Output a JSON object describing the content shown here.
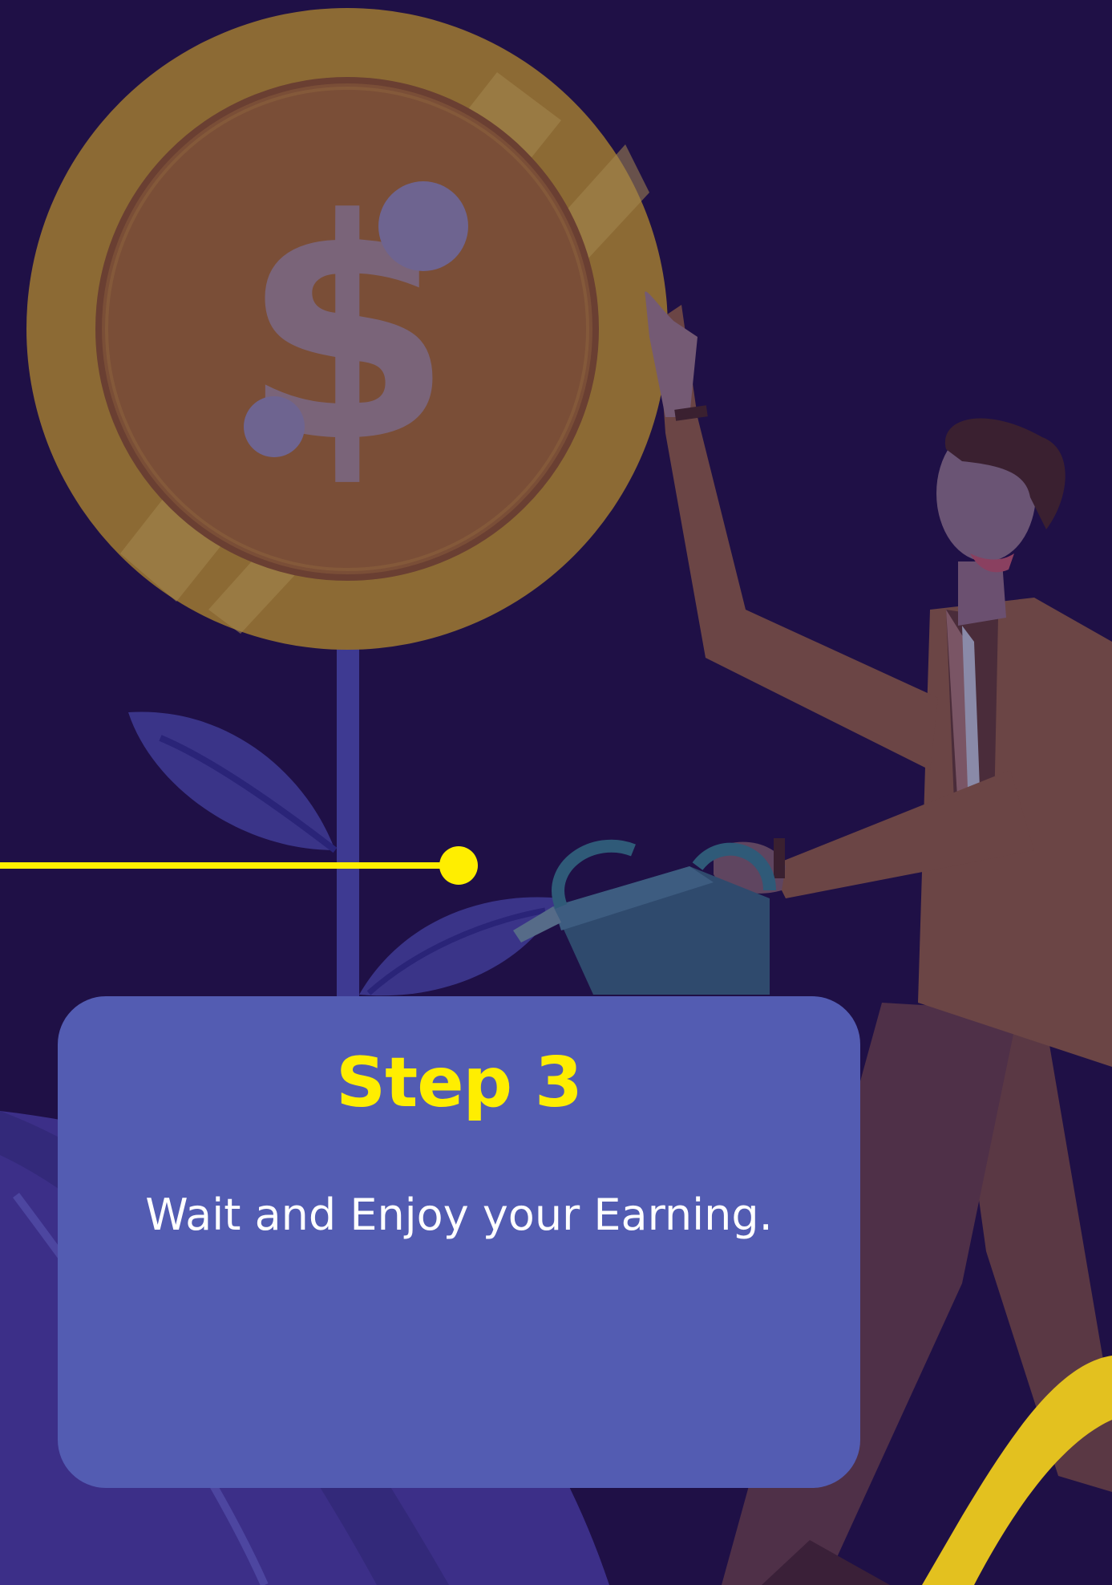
{
  "step": {
    "title": "Step 3",
    "description": "Wait and Enjoy your Earning."
  },
  "illustration": {
    "coin_symbol": "$"
  },
  "colors": {
    "background": "#1f1046",
    "card": "#535cb2",
    "title": "#ffee00",
    "text": "#ffffff",
    "timeline": "#ffee00",
    "coin": "#8c6a34",
    "suit": "#6b4545",
    "leaf": "#3a3488",
    "watering_can": "#2f4a6d"
  }
}
